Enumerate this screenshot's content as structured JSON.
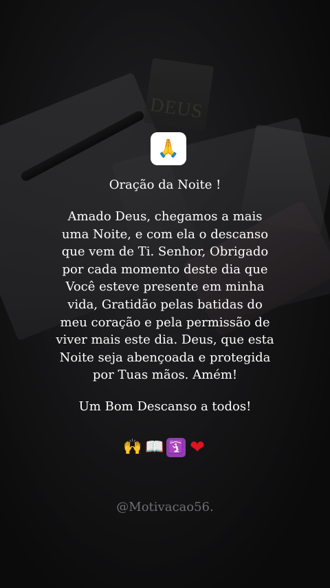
{
  "post": {
    "top_icon": "🙏",
    "title": "Oração da Noite !",
    "body_lines": [
      "Amado Deus, chegamos a mais",
      "uma Noite, e com ela o descanso",
      "que vem de Ti. Senhor, Obrigado",
      "por cada momento deste dia que",
      "Você esteve presente em minha",
      "vida, Gratidão pelas batidas do",
      "meu coração e pela permissão de",
      "viver mais este dia. Deus, que esta",
      "Noite seja abençoada e protegida",
      "por Tuas mãos. Amém!"
    ],
    "closing": "Um Bom Descanso a todos!",
    "emojis": [
      "🙌",
      "📖",
      "🛐",
      "❤"
    ],
    "watermark": "@Motivacao56.",
    "background_book_label": "DEUS"
  },
  "colors": {
    "text": "#ffffff",
    "watermark": "#6f6f73",
    "icon_box": "#ffffff"
  }
}
